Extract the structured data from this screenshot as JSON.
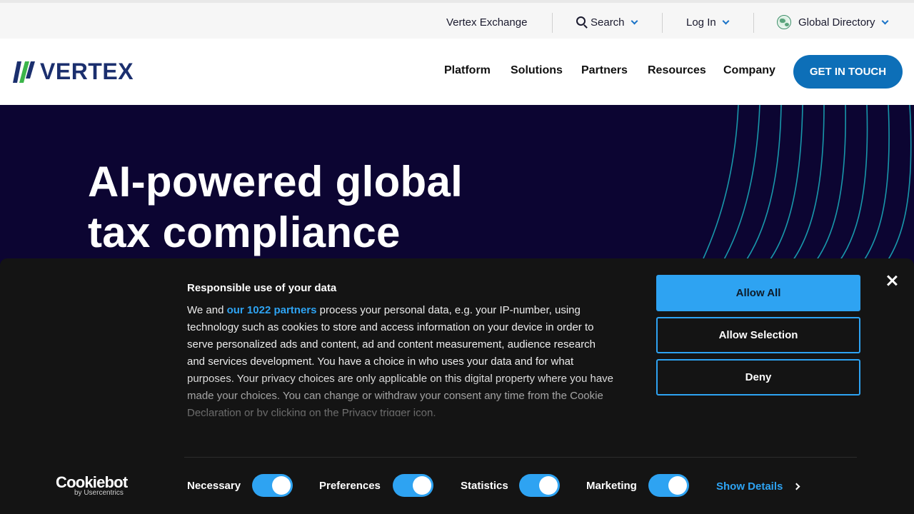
{
  "utility_nav": {
    "exchange": "Vertex Exchange",
    "search": "Search",
    "login": "Log In",
    "directory": "Global Directory"
  },
  "header": {
    "logo_text": "VERTEX",
    "nav": [
      "Platform",
      "Solutions",
      "Partners",
      "Resources",
      "Company"
    ],
    "cta": "GET IN TOUCH"
  },
  "hero": {
    "title_line1": "AI-powered global",
    "title_line2": "tax compliance"
  },
  "cookie_banner": {
    "title": "Responsible use of your data",
    "body_prefix": "We and ",
    "partners_link": "our 1022 partners",
    "body_suffix": " process your personal data, e.g. your IP-number, using technology such as cookies to store and access information on your device in order to serve personalized ads and content, ad and content measurement, audience research and services development. You have a choice in who uses your data and for what purposes. Your privacy choices are only applicable on this digital property where you have made your choices. You can change or withdraw your consent any time from the Cookie Declaration or by clicking on the Privacy trigger icon.",
    "allow_all": "Allow All",
    "allow_selection": "Allow Selection",
    "deny": "Deny",
    "provider_main": "Cookiebot",
    "provider_sub": "by Usercentrics",
    "toggles": [
      {
        "label": "Necessary",
        "on": true
      },
      {
        "label": "Preferences",
        "on": true
      },
      {
        "label": "Statistics",
        "on": true
      },
      {
        "label": "Marketing",
        "on": true
      }
    ],
    "show_details": "Show Details"
  },
  "colors": {
    "accent_blue": "#2ea3f2",
    "cta_blue": "#0d6fb8",
    "hero_bg": "#0c0532",
    "banner_bg": "#141414",
    "arc_teal": "#1aa7b8"
  }
}
